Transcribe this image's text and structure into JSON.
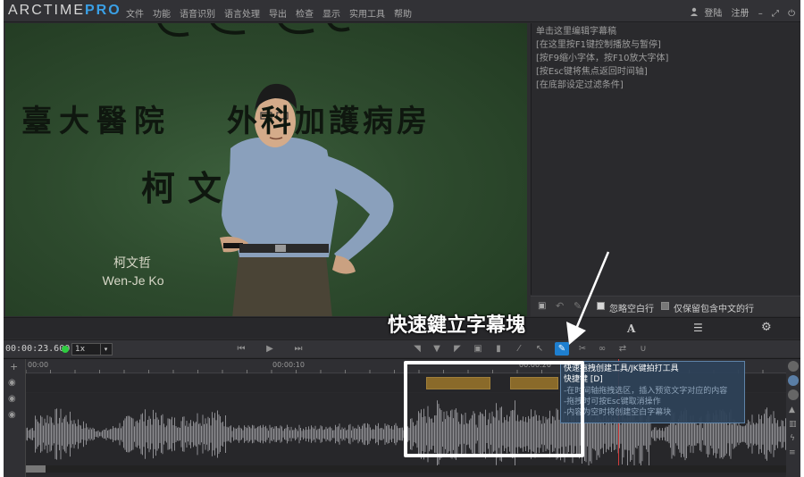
{
  "app": {
    "logo_main": "ARCTIME",
    "logo_accent": "PRO",
    "menu": [
      "文件",
      "功能",
      "语音识别",
      "语言处理",
      "导出",
      "检查",
      "显示",
      "实用工具",
      "帮助"
    ],
    "login": "登陆",
    "register": "注册"
  },
  "video": {
    "slide_line1": "臺大醫院",
    "slide_line2": "外科加護病房",
    "slide_line3": "柯文",
    "caption_cn": "柯文哲",
    "caption_en": "Wen-Je Ko"
  },
  "subtitle_panel": {
    "lines": [
      "单击这里编辑字幕稿",
      "[在这里按F1键控制播放与暂停]",
      "[按F9缩小字体，按F10放大字体]",
      "[按Esc键将焦点返回时间轴]",
      "[在底部设定过滤条件]"
    ],
    "skip_blank_label": "忽略空白行",
    "chinese_only_label": "仅保留包含中文的行"
  },
  "playback": {
    "timecode": "00:00:23.600",
    "speed": "1x",
    "status_color": "#2ecc40"
  },
  "timeline": {
    "ruler_labels": [
      "00:00",
      "00:00:10",
      "00:00:20"
    ]
  },
  "tooltip": {
    "line1": "快速拖拽创建工具/JK键拍打工具",
    "line2": "快捷键 [D]",
    "line3": "-在时间轴拖拽选区，插入预览文字对应的内容",
    "line4": "-拖拽时可按Esc键取消操作",
    "line5": "-内容为空时将创建空白字幕块"
  },
  "annotation": {
    "text": "快速鍵立字幕塊",
    "color": "#ffffff"
  },
  "colors": {
    "accent": "#3aa0e6",
    "active_tool": "#1e7fd0",
    "subtitle_block": "#8a6a2a",
    "playhead": "#d23c3c"
  }
}
